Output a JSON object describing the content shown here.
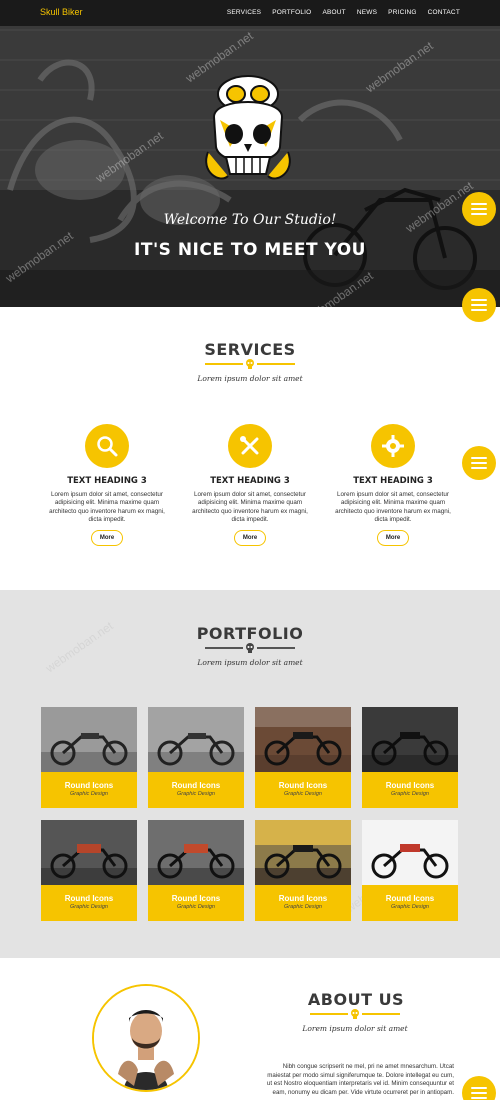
{
  "nav": {
    "brand": "Skull Biker",
    "items": [
      "SERVICES",
      "PORTFOLIO",
      "ABOUT",
      "NEWS",
      "PRICING",
      "CONTACT"
    ]
  },
  "hero": {
    "welcome": "Welcome To Our Studio!",
    "title": "IT'S NICE TO MEET YOU",
    "watermark": "webmoban.net"
  },
  "services": {
    "title": "SERVICES",
    "tagline": "Lorem ipsum dolor sit amet",
    "items": [
      {
        "icon": "magnifier-icon",
        "heading": "TEXT HEADING 3",
        "text_lines": [
          "Lorem ipsum dolor sit amet, consectetur",
          "adipisicing elit. Minima maxime quam",
          "architecto quo inventore harum ex magni,",
          "dicta impedit."
        ],
        "button": "More"
      },
      {
        "icon": "tools-icon",
        "heading": "TEXT HEADING 3",
        "text_lines": [
          "Lorem ipsum dolor sit amet, consectetur",
          "adipisicing elit. Minima maxime quam",
          "architecto quo inventore harum ex magni,",
          "dicta impedit."
        ],
        "button": "More"
      },
      {
        "icon": "gear-icon",
        "heading": "TEXT HEADING 3",
        "text_lines": [
          "Lorem ipsum dolor sit amet, consectetur",
          "adipisicing elit. Minima maxime quam",
          "architecto quo inventore harum ex magni,",
          "dicta impedit."
        ],
        "button": "More"
      }
    ]
  },
  "portfolio": {
    "title": "PORTFOLIO",
    "tagline": "Lorem ipsum dolor sit amet",
    "items": [
      {
        "title": "Round Icons",
        "subtitle": "Graphic Design"
      },
      {
        "title": "Round Icons",
        "subtitle": "Graphic Design"
      },
      {
        "title": "Round Icons",
        "subtitle": "Graphic Design"
      },
      {
        "title": "Round Icons",
        "subtitle": "Graphic Design"
      },
      {
        "title": "Round Icons",
        "subtitle": "Graphic Design"
      },
      {
        "title": "Round Icons",
        "subtitle": "Graphic Design"
      },
      {
        "title": "Round Icons",
        "subtitle": "Graphic Design"
      },
      {
        "title": "Round Icons",
        "subtitle": "Graphic Design"
      }
    ]
  },
  "about": {
    "title": "ABOUT US",
    "tagline": "Lorem ipsum dolor sit amet",
    "text_lines": [
      "Nibh congue scripserit ne mel, pri ne amet mnesarchum. Utcat",
      "maiestat per modo simul signiferumque te. Dolore intellegat eu cum,",
      "ut est Nostro eloquentiam interpretaris vel id. Minim consequuntur et",
      "eam, nonumy eu dicam per. Vide virtute ocurreret per in antiopam."
    ]
  },
  "colors": {
    "accent": "#f6c400",
    "dark": "#222222",
    "gray_bg": "#e3e3e3"
  }
}
